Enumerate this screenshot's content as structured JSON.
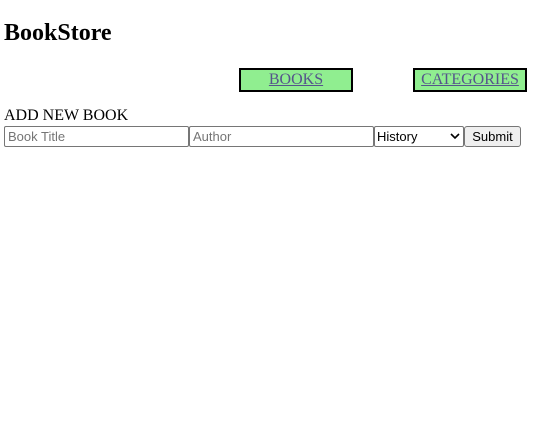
{
  "header": {
    "brand": "BookStore"
  },
  "nav": {
    "items": [
      {
        "label": "BOOKS"
      },
      {
        "label": "CATEGORIES"
      }
    ],
    "background": "#90ee90",
    "link_color": "#55558b"
  },
  "form": {
    "heading": "ADD NEW BOOK",
    "title_input": {
      "placeholder": "Book Title",
      "value": ""
    },
    "author_input": {
      "placeholder": "Author",
      "value": ""
    },
    "category_select": {
      "selected": "History",
      "icon": "chevron-down-icon"
    },
    "submit_label": "Submit"
  }
}
